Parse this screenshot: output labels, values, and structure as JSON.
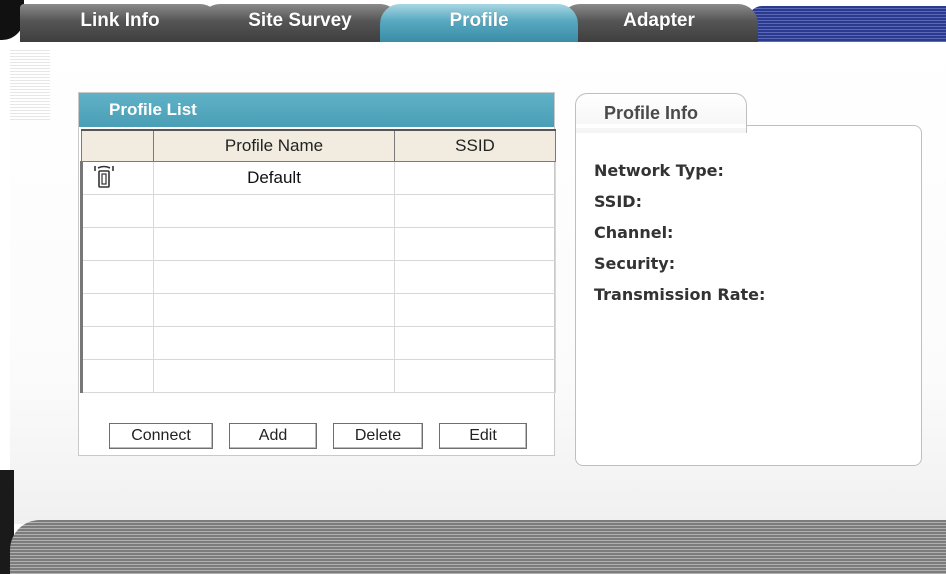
{
  "tabs": [
    {
      "label": "Link Info",
      "active": false
    },
    {
      "label": "Site Survey",
      "active": false
    },
    {
      "label": "Profile",
      "active": true
    },
    {
      "label": "Adapter",
      "active": false
    }
  ],
  "profile_list": {
    "title": "Profile List",
    "columns": [
      "",
      "Profile Name",
      "SSID"
    ],
    "rows": [
      {
        "icon": "active-profile-icon",
        "name": "Default",
        "ssid": ""
      },
      {
        "icon": "",
        "name": "",
        "ssid": ""
      },
      {
        "icon": "",
        "name": "",
        "ssid": ""
      },
      {
        "icon": "",
        "name": "",
        "ssid": ""
      },
      {
        "icon": "",
        "name": "",
        "ssid": ""
      },
      {
        "icon": "",
        "name": "",
        "ssid": ""
      },
      {
        "icon": "",
        "name": "",
        "ssid": ""
      }
    ],
    "buttons": {
      "connect": "Connect",
      "add": "Add",
      "delete": "Delete",
      "edit": "Edit"
    }
  },
  "profile_info": {
    "title": "Profile Info",
    "fields": [
      "Network Type:",
      "SSID:",
      "Channel:",
      "Security:",
      "Transmission Rate:"
    ]
  },
  "colors": {
    "active_tab": "#4a9fb6",
    "inactive_tab": "#555555",
    "header_bar": "#4a9fb6"
  }
}
